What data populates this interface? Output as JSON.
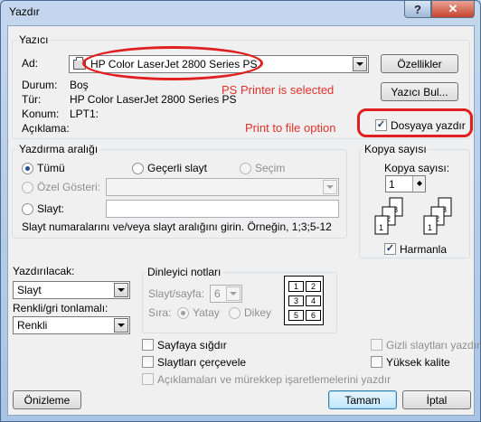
{
  "window": {
    "title": "Yazdır"
  },
  "printer": {
    "group_label": "Yazıcı",
    "name_label": "Ad:",
    "selected": "HP Color LaserJet 2800 Series PS",
    "properties_button": "Özellikler",
    "find_printer_button": "Yazıcı Bul...",
    "status_label": "Durum:",
    "status_value": "Boş",
    "type_label": "Tür:",
    "type_value": "HP Color LaserJet 2800 Series PS",
    "location_label": "Konum:",
    "location_value": "LPT1:",
    "comment_label": "Açıklama:",
    "print_to_file_label": "Dosyaya yazdır",
    "print_to_file_checked": true
  },
  "annotations": {
    "ps_printer": "PS Printer is selected",
    "print_to_file": "Print to file option"
  },
  "print_range": {
    "group_label": "Yazdırma aralığı",
    "all": "Tümü",
    "current_slide": "Geçerli slayt",
    "selection": "Seçim",
    "custom_show": "Özel Gösteri:",
    "slides": "Slayt:",
    "hint": "Slayt numaralarını ve/veya slayt aralığını girin. Örneğin, 1;3;5-12"
  },
  "copies": {
    "group_label": "Kopya sayısı",
    "count_label": "Kopya sayısı:",
    "count_value": "1",
    "collate_label": "Harmanla",
    "collate_checked": true
  },
  "print_what": {
    "label": "Yazdırılacak:",
    "value": "Slayt"
  },
  "color": {
    "label": "Renkli/gri tonlamalı:",
    "value": "Renkli"
  },
  "handouts": {
    "group_label": "Dinleyici notları",
    "per_page_label": "Slayt/sayfa:",
    "per_page_value": "6",
    "order_label": "Sıra:",
    "horizontal": "Yatay",
    "vertical": "Dikey",
    "preview_numbers": [
      "1",
      "2",
      "3",
      "4",
      "5",
      "6"
    ]
  },
  "options": {
    "scale_to_fit": "Sayfaya sığdır",
    "frame_slides": "Slaytları çerçevele",
    "print_comments": "Açıklamaları ve mürekkep işaretlemelerini yazdır",
    "hidden_slides": "Gizli slaytları yazdır",
    "high_quality": "Yüksek kalite"
  },
  "footer": {
    "preview_button": "Önizleme",
    "ok_button": "Tamam",
    "cancel_button": "İptal"
  }
}
